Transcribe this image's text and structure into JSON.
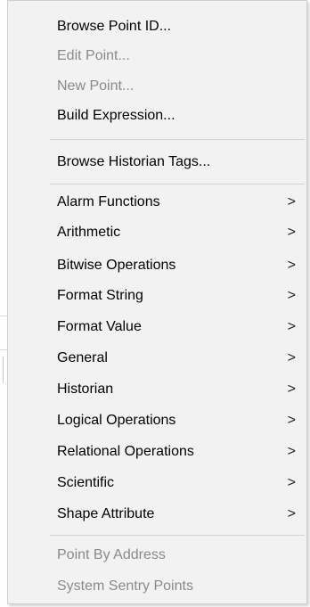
{
  "menu": {
    "group1": [
      {
        "label": "Browse Point ID...",
        "enabled": true
      },
      {
        "label": "Edit Point...",
        "enabled": false
      },
      {
        "label": "New Point...",
        "enabled": false
      },
      {
        "label": "Build Expression...",
        "enabled": true
      }
    ],
    "group2": [
      {
        "label": "Browse Historian Tags...",
        "enabled": true
      }
    ],
    "submenus": [
      {
        "label": "Alarm Functions",
        "arrow": ">"
      },
      {
        "label": "Arithmetic",
        "arrow": ">"
      },
      {
        "label": "Bitwise Operations",
        "arrow": ">"
      },
      {
        "label": "Format String",
        "arrow": ">"
      },
      {
        "label": "Format Value",
        "arrow": ">"
      },
      {
        "label": "General",
        "arrow": ">"
      },
      {
        "label": "Historian",
        "arrow": ">"
      },
      {
        "label": "Logical Operations",
        "arrow": ">"
      },
      {
        "label": "Relational Operations",
        "arrow": ">"
      },
      {
        "label": "Scientific",
        "arrow": ">"
      },
      {
        "label": "Shape Attribute",
        "arrow": ">"
      }
    ],
    "group4": [
      {
        "label": "Point By Address",
        "enabled": false
      },
      {
        "label": "System Sentry Points",
        "enabled": false
      }
    ]
  },
  "colors": {
    "menu_bg": "#f2f2f2",
    "text": "#000000",
    "disabled_text": "#8a8a8a",
    "separator": "#d4d4d4"
  }
}
